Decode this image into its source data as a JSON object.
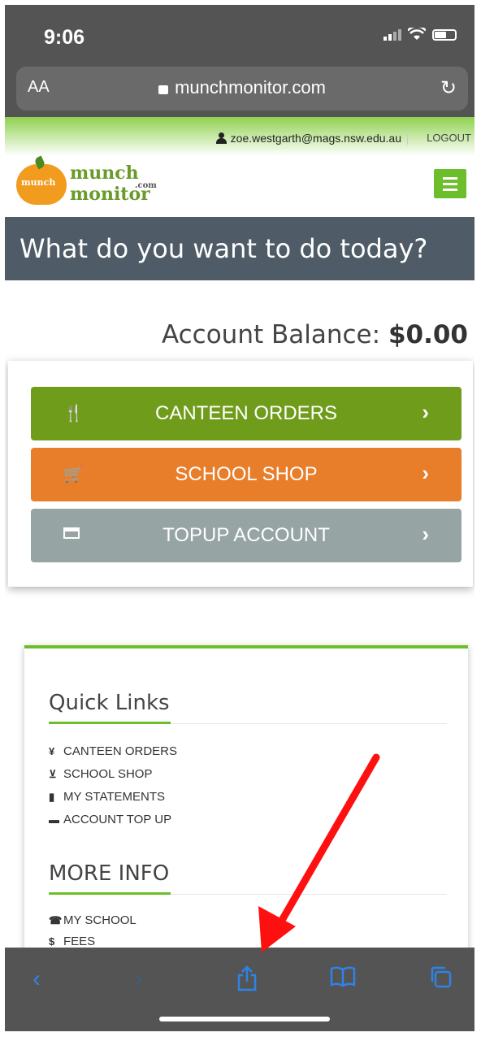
{
  "status_bar": {
    "time": "9:06"
  },
  "browser": {
    "text_size": "AA",
    "url": "munchmonitor.com"
  },
  "user_bar": {
    "email": "zoe.westgarth@mags.nsw.edu.au",
    "logout": "LOGOUT"
  },
  "logo": {
    "line1": "munch",
    "line2": "monitor",
    "com": ".com",
    "badge": "munch"
  },
  "headline": "What do you want to do today?",
  "balance": {
    "label": "Account Balance:",
    "value": "$0.00"
  },
  "actions": [
    {
      "label": "CANTEEN ORDERS",
      "color": "#6f9c1a",
      "icon": "cutlery-icon"
    },
    {
      "label": "SCHOOL SHOP",
      "color": "#e87d2a",
      "icon": "cart-icon"
    },
    {
      "label": "TOPUP ACCOUNT",
      "color": "#96a4a4",
      "icon": "credit-card-icon"
    }
  ],
  "quick_links": {
    "title": "Quick Links",
    "items": [
      "CANTEEN ORDERS",
      "SCHOOL SHOP",
      "MY STATEMENTS",
      "ACCOUNT TOP UP"
    ]
  },
  "more_info": {
    "title": "MORE INFO",
    "items": [
      "MY SCHOOL",
      "FEES"
    ]
  },
  "toolbar": {
    "icons": [
      "back-icon",
      "forward-icon",
      "share-icon",
      "bookmarks-icon",
      "tabs-icon"
    ]
  },
  "colors": {
    "accent_green": "#6cbf2a",
    "header_bg": "#4f5b66",
    "annotation_arrow": "#ff0000"
  }
}
